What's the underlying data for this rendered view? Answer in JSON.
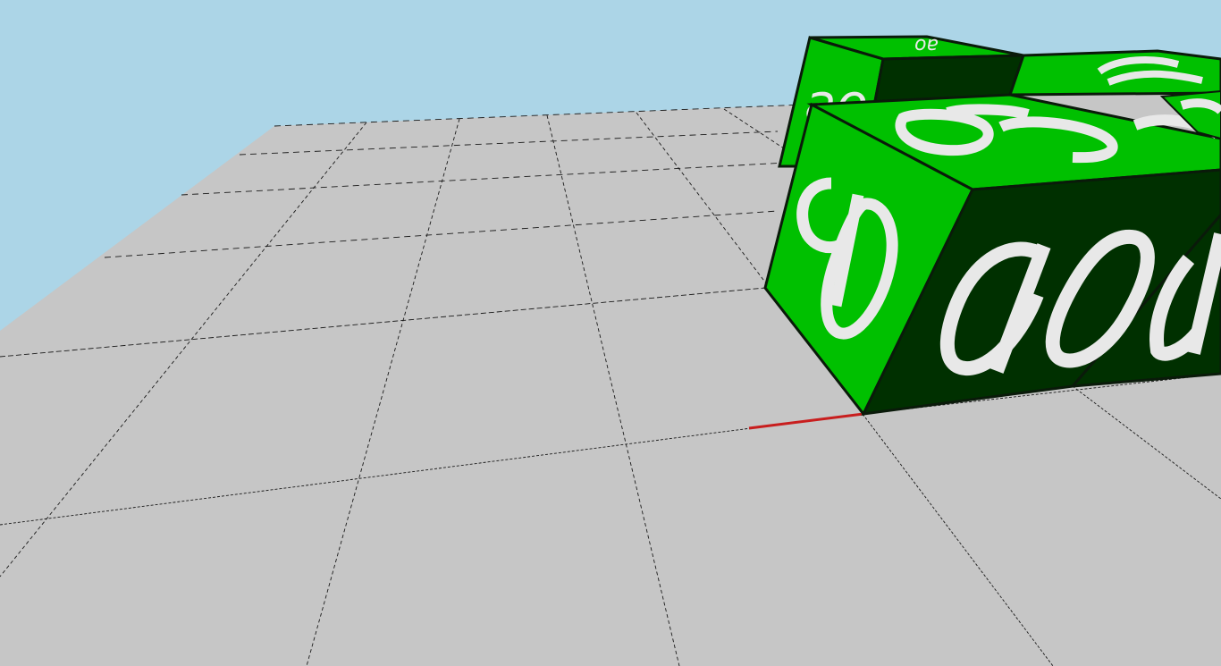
{
  "scene": {
    "sky_color": "#acd5e7",
    "floor_color": "#c6c6c6",
    "grid_line_color": "#1a1a1a",
    "axis_marker_color": "#c81e1e",
    "cube_front_color": "#00c000",
    "cube_side_color": "#003000",
    "cube_edge_color": "#0a1a0a",
    "cube_text_color": "#e8e8e8"
  },
  "blocks": [
    {
      "label": "ao"
    },
    {
      "label": "ao"
    },
    {
      "label": "ao"
    },
    {
      "label": "ao"
    }
  ]
}
